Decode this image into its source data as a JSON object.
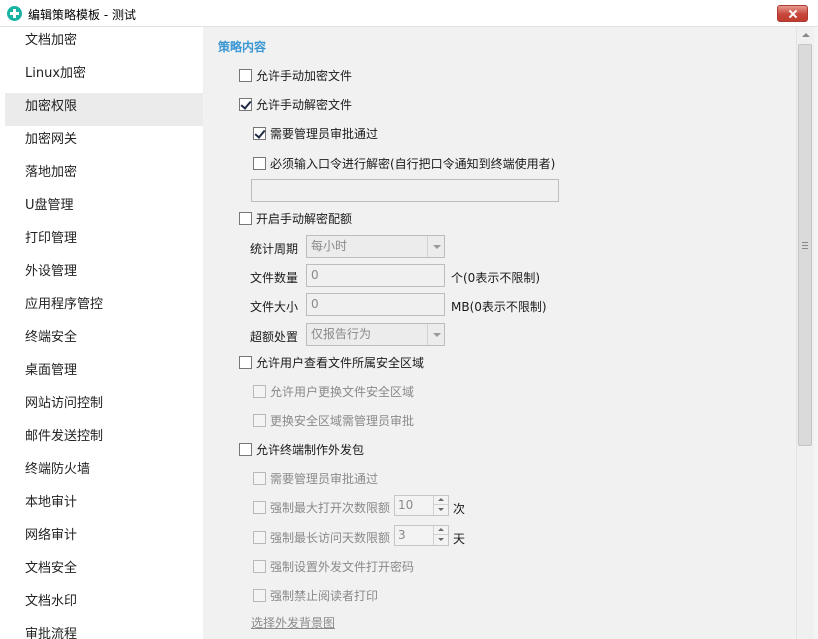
{
  "window": {
    "title": "编辑策略模板 - 测试",
    "icon": "shield-app-icon",
    "close_icon": "close-icon"
  },
  "sidebar": {
    "items": [
      {
        "label": "文档加密",
        "selected": false
      },
      {
        "label": "Linux加密",
        "selected": false
      },
      {
        "label": "加密权限",
        "selected": true
      },
      {
        "label": "加密网关",
        "selected": false
      },
      {
        "label": "落地加密",
        "selected": false
      },
      {
        "label": "U盘管理",
        "selected": false
      },
      {
        "label": "打印管理",
        "selected": false
      },
      {
        "label": "外设管理",
        "selected": false
      },
      {
        "label": "应用程序管控",
        "selected": false
      },
      {
        "label": "终端安全",
        "selected": false
      },
      {
        "label": "桌面管理",
        "selected": false
      },
      {
        "label": "网站访问控制",
        "selected": false
      },
      {
        "label": "邮件发送控制",
        "selected": false
      },
      {
        "label": "终端防火墙",
        "selected": false
      },
      {
        "label": "本地审计",
        "selected": false
      },
      {
        "label": "网络审计",
        "selected": false
      },
      {
        "label": "文档安全",
        "selected": false
      },
      {
        "label": "文档水印",
        "selected": false
      },
      {
        "label": "审批流程",
        "selected": false
      }
    ]
  },
  "policy": {
    "section_title": "策略内容",
    "allow_manual_encrypt": {
      "label": "允许手动加密文件",
      "checked": false
    },
    "allow_manual_decrypt": {
      "label": "允许手动解密文件",
      "checked": true
    },
    "require_admin_approval": {
      "label": "需要管理员审批通过",
      "checked": true
    },
    "require_password": {
      "label": "必须输入口令进行解密(自行把口令通知到终端使用者)",
      "checked": false,
      "value": ""
    },
    "decrypt_quota": {
      "label": "开启手动解密配额",
      "checked": false,
      "period_label": "统计周期",
      "period_value": "每小时",
      "count_label": "文件数量",
      "count_value": "0",
      "count_hint": "个(0表示不限制)",
      "size_label": "文件大小",
      "size_value": "0",
      "size_hint": "MB(0表示不限制)",
      "over_label": "超额处置",
      "over_value": "仅报告行为"
    },
    "view_security_zone": {
      "label": "允许用户查看文件所属安全区域",
      "checked": false
    },
    "change_zone": {
      "label": "允许用户更换文件安全区域",
      "checked": false
    },
    "change_zone_approval": {
      "label": "更换安全区域需管理员审批",
      "checked": false
    },
    "outgoing_package": {
      "label": "允许终端制作外发包",
      "checked": false
    },
    "outgoing_admin_approval": {
      "label": "需要管理员审批通过",
      "checked": false
    },
    "max_open": {
      "label": "强制最大打开次数限额",
      "checked": false,
      "value": "10",
      "unit": "次"
    },
    "max_days": {
      "label": "强制最长访问天数限额",
      "checked": false,
      "value": "3",
      "unit": "天"
    },
    "set_password": {
      "label": "强制设置外发文件打开密码",
      "checked": false
    },
    "no_print": {
      "label": "强制禁止阅读者打印",
      "checked": false
    },
    "background_link": "选择外发背景图"
  }
}
